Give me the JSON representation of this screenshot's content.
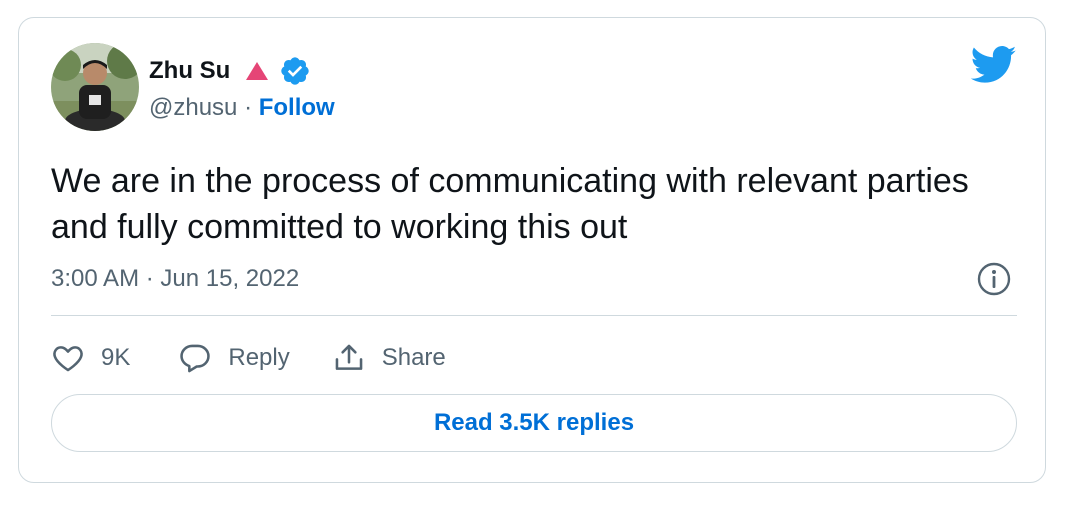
{
  "author": {
    "name": "Zhu Su",
    "handle": "@zhusu",
    "separator": " · ",
    "follow_label": "Follow"
  },
  "icons": {
    "bird": "twitter-bird-icon",
    "verified": "verified-badge-icon",
    "triangle": "red-triangle-icon",
    "info": "info-icon",
    "like": "heart-icon",
    "reply": "speech-bubble-icon",
    "share": "share-upload-icon"
  },
  "colors": {
    "brand_blue": "#1d9bf0",
    "link_blue": "#006fd6",
    "triangle_red": "#e0245e",
    "muted_text": "#536471"
  },
  "tweet": {
    "text": "We are in the process of communicating with relevant parties and fully committed to working this out",
    "timestamp": "3:00 AM · Jun 15, 2022"
  },
  "actions": {
    "like_count": "9K",
    "reply_label": "Reply",
    "share_label": "Share"
  },
  "footer": {
    "read_replies_label": "Read 3.5K replies"
  }
}
